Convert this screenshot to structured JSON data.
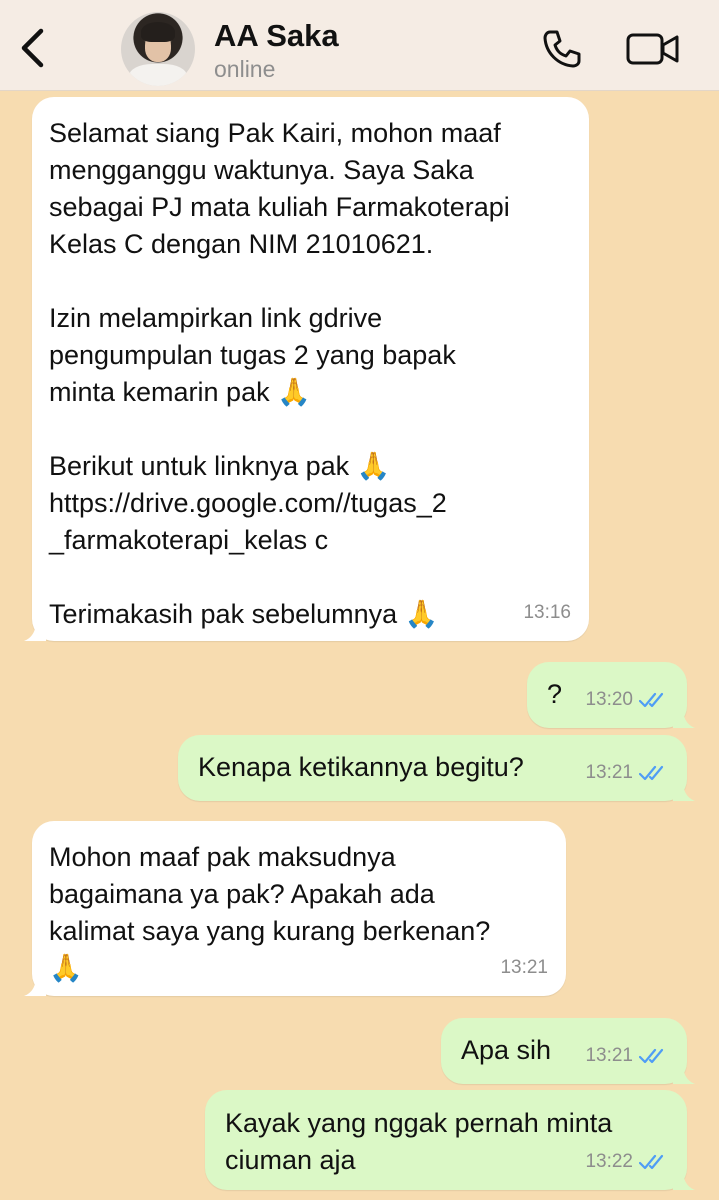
{
  "header": {
    "contact_name": "AA Saka",
    "status": "online"
  },
  "icons": {
    "back": "chevron-left-icon",
    "call": "phone-icon",
    "video": "video-camera-icon",
    "read_receipt": "double-check-icon"
  },
  "colors": {
    "chat_background": "#f7dcb0",
    "incoming_bubble": "#ffffff",
    "outgoing_bubble": "#dbf8c6",
    "read_tick": "#4f9df5"
  },
  "messages": [
    {
      "direction": "in",
      "text": "Selamat siang Pak Kairi, mohon maaf\nmengganggu waktunya. Saya Saka\nsebagai PJ mata kuliah Farmakoterapi\nKelas C dengan NIM 21010621.\n\nIzin melampirkan link gdrive\npengumpulan tugas 2 yang bapak\nminta kemarin pak 🙏\n\nBerikut untuk linknya pak 🙏\nhttps://drive.google.com//tugas_2\n_farmakoterapi_kelas c\n\nTerimakasih pak sebelumnya 🙏",
      "time": "13:16"
    },
    {
      "direction": "out",
      "text": "?",
      "time": "13:20"
    },
    {
      "direction": "out",
      "text": "Kenapa ketikannya begitu?",
      "time": "13:21"
    },
    {
      "direction": "in",
      "text": "Mohon maaf pak maksudnya\nbagaimana ya pak? Apakah ada\nkalimat saya yang kurang berkenan?\n🙏",
      "time": "13:21"
    },
    {
      "direction": "out",
      "text": "Apa sih",
      "time": "13:21"
    },
    {
      "direction": "out",
      "text": "Kayak yang nggak pernah minta\nciuman aja",
      "time": "13:22"
    }
  ]
}
